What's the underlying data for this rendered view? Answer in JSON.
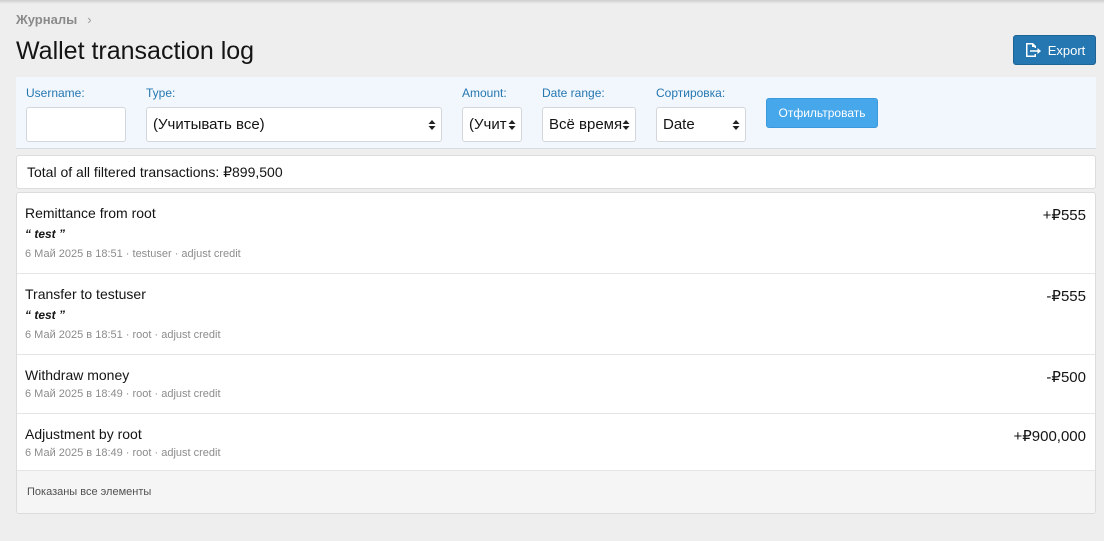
{
  "breadcrumb": {
    "label": "Журналы",
    "chevron": "›"
  },
  "page": {
    "title": "Wallet transaction log"
  },
  "export": {
    "label": "Export",
    "icon": "export-icon",
    "color": "#2577b1"
  },
  "filters": {
    "username": {
      "label": "Username:",
      "value": ""
    },
    "type": {
      "label": "Type:",
      "value": "(Учитывать все)"
    },
    "amount": {
      "label": "Amount:",
      "value": "(Учит"
    },
    "date_range": {
      "label": "Date range:",
      "value": "Всё время"
    },
    "sort": {
      "label": "Сортировка:",
      "value": "Date"
    },
    "submit_label": "Отфильтровать"
  },
  "total": {
    "text": "Total of all filtered transactions: ₽899,500"
  },
  "transactions": [
    {
      "title": "Remittance from root",
      "note": "“ test ”",
      "meta": "6 Май 2025 в 18:51 · testuser · adjust credit",
      "amount": "+₽555"
    },
    {
      "title": "Transfer to testuser",
      "note": "“ test ”",
      "meta": "6 Май 2025 в 18:51 · root · adjust credit",
      "amount": "-₽555"
    },
    {
      "title": "Withdraw money",
      "meta": "6 Май 2025 в 18:49 · root · adjust credit",
      "amount": "-₽500"
    },
    {
      "title": "Adjustment by root",
      "meta": "6 Май 2025 в 18:49 · root · adjust credit",
      "amount": "+₽900,000"
    }
  ],
  "footer": {
    "text": "Показаны все элементы"
  },
  "colors": {
    "accent": "#2577b1",
    "filter_button": "#47a7eb",
    "filter_bg": "#f2f7fd"
  }
}
